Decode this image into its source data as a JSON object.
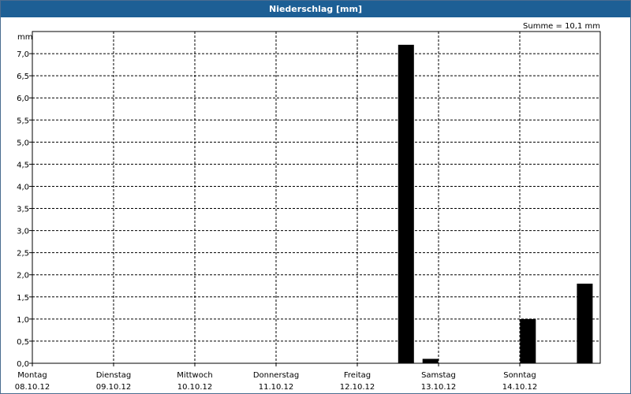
{
  "window": {
    "title": "Niederschlag [mm]"
  },
  "chart_data": {
    "type": "bar",
    "title": "Niederschlag [mm]",
    "ylabel": "mm",
    "annotation": "Summe = 10,1 mm",
    "ylim": [
      0,
      7.5
    ],
    "yticks": [
      "0,0",
      "0,5",
      "1,0",
      "1,5",
      "2,0",
      "2,5",
      "3,0",
      "3,5",
      "4,0",
      "4,5",
      "5,0",
      "5,5",
      "6,0",
      "6,5",
      "7,0"
    ],
    "grid": true,
    "days": [
      {
        "day": "Montag",
        "date": "08.10.12"
      },
      {
        "day": "Dienstag",
        "date": "09.10.12"
      },
      {
        "day": "Mittwoch",
        "date": "10.10.12"
      },
      {
        "day": "Donnerstag",
        "date": "11.10.12"
      },
      {
        "day": "Freitag",
        "date": "12.10.12"
      },
      {
        "day": "Samstag",
        "date": "13.10.12"
      },
      {
        "day": "Sonntag",
        "date": "14.10.12"
      }
    ],
    "x_unit": "day-offset from 08.10.12 00:00",
    "series": [
      {
        "values": [
          {
            "x": 4.6,
            "y": 7.2
          },
          {
            "x": 4.9,
            "y": 0.1
          },
          {
            "x": 6.1,
            "y": 1.0
          },
          {
            "x": 6.8,
            "y": 1.8
          }
        ]
      }
    ],
    "bar_color": "#000000"
  }
}
